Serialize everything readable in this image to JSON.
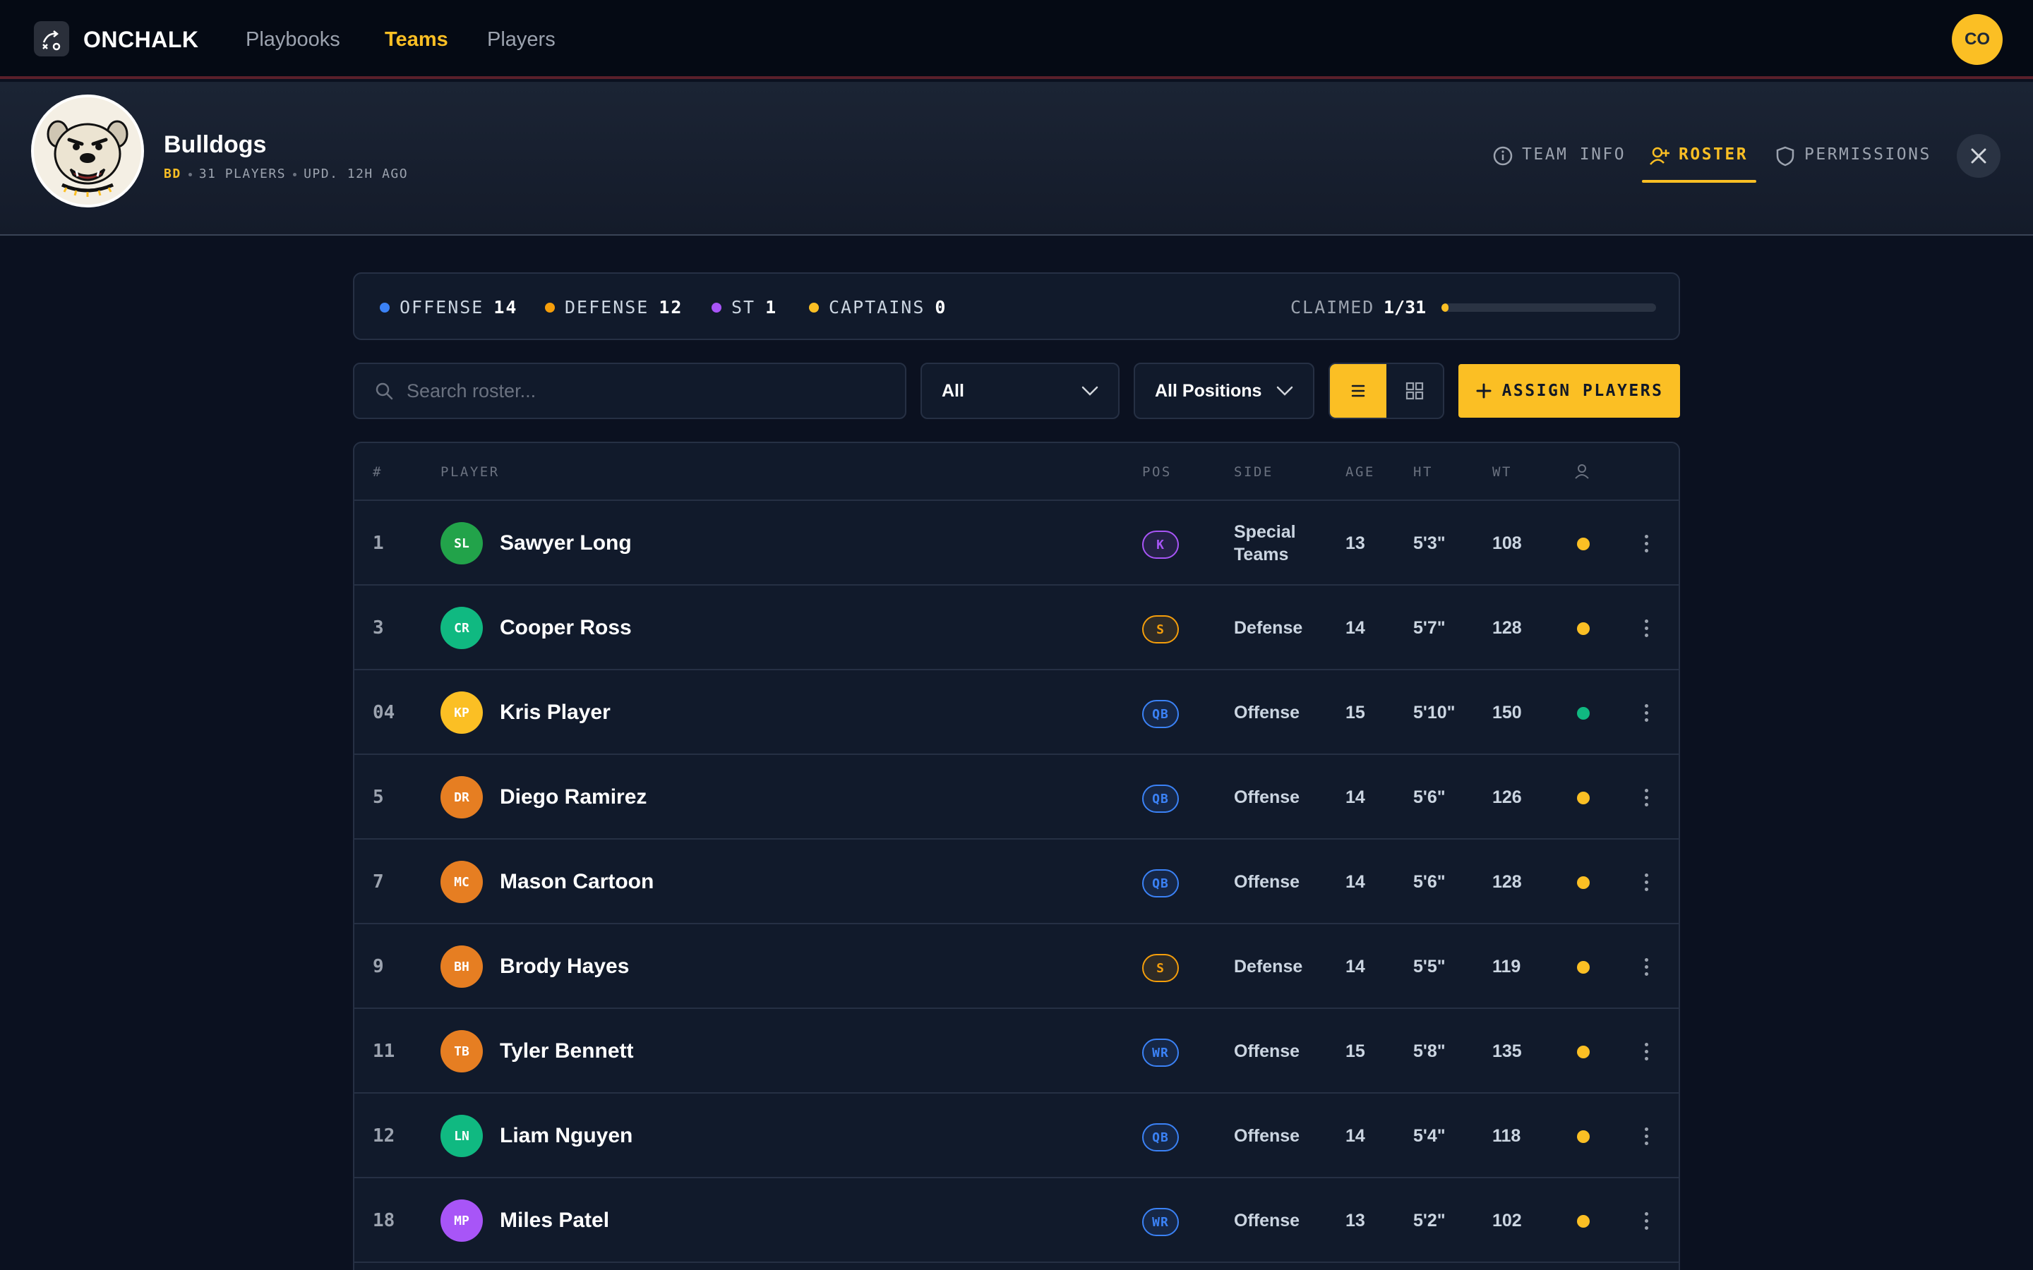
{
  "app": {
    "brand": "ONCHALK",
    "nav": [
      {
        "label": "Playbooks",
        "active": false
      },
      {
        "label": "Teams",
        "active": true
      },
      {
        "label": "Players",
        "active": false
      }
    ],
    "user_initials": "CO"
  },
  "team": {
    "name": "Bulldogs",
    "abbr": "BD",
    "players_text": "31 PLAYERS",
    "updated_text": "UPD. 12H AGO",
    "tabs": [
      {
        "label": "TEAM INFO",
        "icon": "info-icon",
        "active": false
      },
      {
        "label": "ROSTER",
        "icon": "user-plus-icon",
        "active": true
      },
      {
        "label": "PERMISSIONS",
        "icon": "shield-icon",
        "active": false
      }
    ]
  },
  "stats": {
    "offense": {
      "label": "OFFENSE",
      "value": "14",
      "color": "#3b82f6"
    },
    "defense": {
      "label": "DEFENSE",
      "value": "12",
      "color": "#f59e0b"
    },
    "st": {
      "label": "ST",
      "value": "1",
      "color": "#a855f7"
    },
    "captains": {
      "label": "CAPTAINS",
      "value": "0",
      "color": "#fbbf24"
    },
    "claimed_label": "CLAIMED",
    "claimed_value": "1/31",
    "claimed_fraction": 0.032
  },
  "toolbar": {
    "search_placeholder": "Search roster...",
    "side_filter": "All",
    "position_filter": "All Positions",
    "view_mode": "list",
    "assign_label": "ASSIGN PLAYERS"
  },
  "table": {
    "headers": {
      "num": "#",
      "player": "PLAYER",
      "pos": "POS",
      "side": "SIDE",
      "age": "AGE",
      "ht": "HT",
      "wt": "WT"
    },
    "rows": [
      {
        "num": "1",
        "initials": "SL",
        "avatar_color": "#22a34a",
        "name": "Sawyer Long",
        "pos": "K",
        "pos_color": "#a855f7",
        "side": "Special Teams",
        "age": "13",
        "ht": "5'3\"",
        "wt": "108",
        "status_color": "#fbbf24"
      },
      {
        "num": "3",
        "initials": "CR",
        "avatar_color": "#10b981",
        "name": "Cooper Ross",
        "pos": "S",
        "pos_color": "#f59e0b",
        "side": "Defense",
        "age": "14",
        "ht": "5'7\"",
        "wt": "128",
        "status_color": "#fbbf24"
      },
      {
        "num": "04",
        "initials": "KP",
        "avatar_color": "#fbbf24",
        "name": "Kris Player",
        "pos": "QB",
        "pos_color": "#3b82f6",
        "side": "Offense",
        "age": "15",
        "ht": "5'10\"",
        "wt": "150",
        "status_color": "#10b981"
      },
      {
        "num": "5",
        "initials": "DR",
        "avatar_color": "#e67e22",
        "name": "Diego Ramirez",
        "pos": "QB",
        "pos_color": "#3b82f6",
        "side": "Offense",
        "age": "14",
        "ht": "5'6\"",
        "wt": "126",
        "status_color": "#fbbf24"
      },
      {
        "num": "7",
        "initials": "MC",
        "avatar_color": "#e67e22",
        "name": "Mason Cartoon",
        "pos": "QB",
        "pos_color": "#3b82f6",
        "side": "Offense",
        "age": "14",
        "ht": "5'6\"",
        "wt": "128",
        "status_color": "#fbbf24"
      },
      {
        "num": "9",
        "initials": "BH",
        "avatar_color": "#e67e22",
        "name": "Brody Hayes",
        "pos": "S",
        "pos_color": "#f59e0b",
        "side": "Defense",
        "age": "14",
        "ht": "5'5\"",
        "wt": "119",
        "status_color": "#fbbf24"
      },
      {
        "num": "11",
        "initials": "TB",
        "avatar_color": "#e67e22",
        "name": "Tyler Bennett",
        "pos": "WR",
        "pos_color": "#3b82f6",
        "side": "Offense",
        "age": "15",
        "ht": "5'8\"",
        "wt": "135",
        "status_color": "#fbbf24"
      },
      {
        "num": "12",
        "initials": "LN",
        "avatar_color": "#10b981",
        "name": "Liam Nguyen",
        "pos": "QB",
        "pos_color": "#3b82f6",
        "side": "Offense",
        "age": "14",
        "ht": "5'4\"",
        "wt": "118",
        "status_color": "#fbbf24"
      },
      {
        "num": "18",
        "initials": "MP",
        "avatar_color": "#a855f7",
        "name": "Miles Patel",
        "pos": "WR",
        "pos_color": "#3b82f6",
        "side": "Offense",
        "age": "13",
        "ht": "5'2\"",
        "wt": "102",
        "status_color": "#fbbf24"
      }
    ]
  }
}
